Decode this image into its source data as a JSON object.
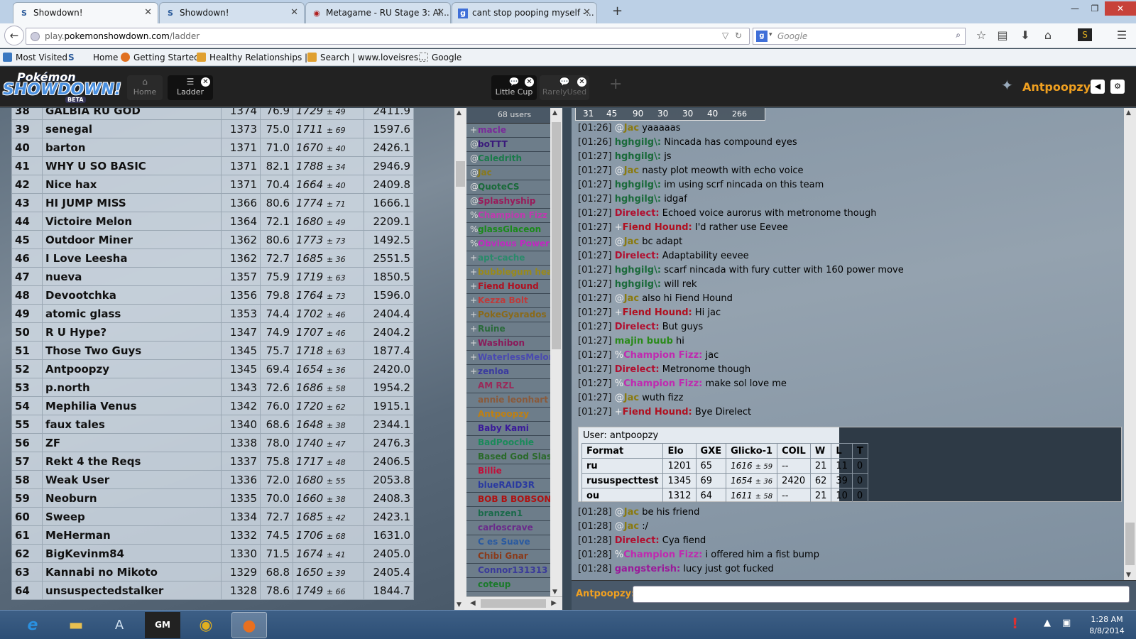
{
  "browser": {
    "tabs": [
      {
        "title": "Showdown!",
        "favicon": "S"
      },
      {
        "title": "Showdown!",
        "favicon": "S"
      },
      {
        "title": "Metagame - RU Stage 3: Al...",
        "favicon": "◉"
      },
      {
        "title": "cant stop pooping myself -...",
        "favicon": "g"
      }
    ],
    "new_tab": "+",
    "url_prefix": "play.",
    "url_domain": "pokemonshowdown.com",
    "url_path": "/ladder",
    "search_placeholder": "Google",
    "bookmarks": [
      "Most Visited",
      "Home",
      "Getting Started",
      "Healthy Relationships |...",
      "Search | www.loveisres...",
      "Google"
    ]
  },
  "showdown": {
    "logo_top": "Pokémon",
    "logo_main": "SHOWDOWN!",
    "logo_beta": "BETA",
    "tabs": [
      {
        "label": "Home",
        "icon": "⌂"
      },
      {
        "label": "Ladder",
        "icon": "☰"
      },
      {
        "label": "Little Cup",
        "icon": "💬"
      },
      {
        "label": "RarelyUsed",
        "icon": "💬"
      }
    ],
    "add_tab": "+",
    "username": "Antpoopzy"
  },
  "ladder": {
    "rows": [
      [
        "38",
        "GALBIA RU GOD",
        "1374",
        "76.9",
        "1729",
        "± 49",
        "2411.9"
      ],
      [
        "39",
        "senegal",
        "1373",
        "75.0",
        "1711",
        "± 69",
        "1597.6"
      ],
      [
        "40",
        "barton",
        "1371",
        "71.0",
        "1670",
        "± 40",
        "2426.1"
      ],
      [
        "41",
        "WHY U SO BASIC",
        "1371",
        "82.1",
        "1788",
        "± 34",
        "2946.9"
      ],
      [
        "42",
        "Nice hax",
        "1371",
        "70.4",
        "1664",
        "± 40",
        "2409.8"
      ],
      [
        "43",
        "HI JUMP MISS",
        "1366",
        "80.6",
        "1774",
        "± 71",
        "1666.1"
      ],
      [
        "44",
        "Victoire Melon",
        "1364",
        "72.1",
        "1680",
        "± 49",
        "2209.1"
      ],
      [
        "45",
        "Outdoor Miner",
        "1362",
        "80.6",
        "1773",
        "± 73",
        "1492.5"
      ],
      [
        "46",
        "I Love Leesha",
        "1362",
        "72.7",
        "1685",
        "± 36",
        "2551.5"
      ],
      [
        "47",
        "nueva",
        "1357",
        "75.9",
        "1719",
        "± 63",
        "1850.5"
      ],
      [
        "48",
        "Devootchka",
        "1356",
        "79.8",
        "1764",
        "± 73",
        "1596.0"
      ],
      [
        "49",
        "atomic glass",
        "1353",
        "74.4",
        "1702",
        "± 46",
        "2404.4"
      ],
      [
        "50",
        "R U Hype?",
        "1347",
        "74.9",
        "1707",
        "± 46",
        "2404.2"
      ],
      [
        "51",
        "Those Two Guys",
        "1345",
        "75.7",
        "1718",
        "± 63",
        "1877.4"
      ],
      [
        "52",
        "Antpoopzy",
        "1345",
        "69.4",
        "1654",
        "± 36",
        "2420.0"
      ],
      [
        "53",
        "p.north",
        "1343",
        "72.6",
        "1686",
        "± 58",
        "1954.2"
      ],
      [
        "54",
        "Mephilia Venus",
        "1342",
        "76.0",
        "1720",
        "± 62",
        "1915.1"
      ],
      [
        "55",
        "faux tales",
        "1340",
        "68.6",
        "1648",
        "± 38",
        "2344.1"
      ],
      [
        "56",
        "ZF",
        "1338",
        "78.0",
        "1740",
        "± 47",
        "2476.3"
      ],
      [
        "57",
        "Rekt 4 the Reqs",
        "1337",
        "75.8",
        "1717",
        "± 48",
        "2406.5"
      ],
      [
        "58",
        "Weak User",
        "1336",
        "72.0",
        "1680",
        "± 55",
        "2053.8"
      ],
      [
        "59",
        "Neoburn",
        "1335",
        "70.0",
        "1660",
        "± 38",
        "2408.3"
      ],
      [
        "60",
        "Sweep",
        "1334",
        "72.7",
        "1685",
        "± 42",
        "2423.1"
      ],
      [
        "61",
        "MeHerman",
        "1332",
        "74.5",
        "1706",
        "± 68",
        "1631.0"
      ],
      [
        "62",
        "BigKevinm84",
        "1330",
        "71.5",
        "1674",
        "± 41",
        "2405.0"
      ],
      [
        "63",
        "Kannabi no Mikoto",
        "1329",
        "68.8",
        "1650",
        "± 39",
        "2405.4"
      ],
      [
        "64",
        "unsuspectedstalker",
        "1328",
        "78.6",
        "1749",
        "± 66",
        "1844.7"
      ]
    ]
  },
  "userlist": {
    "count": "68 users",
    "users": [
      {
        "g": "+",
        "n": "macle",
        "c": "#7a2a9a"
      },
      {
        "g": "@",
        "n": "boTTT",
        "c": "#3a1a7a"
      },
      {
        "g": "@",
        "n": "Caledrith",
        "c": "#1a7a4a"
      },
      {
        "g": "@",
        "n": "Jac",
        "c": "#8a7a1a"
      },
      {
        "g": "@",
        "n": "QuoteCS",
        "c": "#1a6a3a"
      },
      {
        "g": "@",
        "n": "Splashyship",
        "c": "#9a1a5a"
      },
      {
        "g": "%",
        "n": "Champion Fizz",
        "c": "#c03ab0"
      },
      {
        "g": "%",
        "n": "glassGlaceon",
        "c": "#1a8a1a"
      },
      {
        "g": "%",
        "n": "Obvious Power",
        "c": "#c02ac0"
      },
      {
        "g": "+",
        "n": "apt-cache",
        "c": "#2a8a6a"
      },
      {
        "g": "+",
        "n": "bubblegum heart",
        "c": "#9a8a1a"
      },
      {
        "g": "+",
        "n": "Fiend Hound",
        "c": "#b01020"
      },
      {
        "g": "+",
        "n": "Kezza Bolt",
        "c": "#c03a3a"
      },
      {
        "g": "+",
        "n": "PokeGyarados",
        "c": "#8a6a1a"
      },
      {
        "g": "+",
        "n": "Ruine",
        "c": "#2a6a3a"
      },
      {
        "g": "+",
        "n": "Washibon",
        "c": "#8a1a5a"
      },
      {
        "g": "+",
        "n": "WaterlessMelon",
        "c": "#4a4ab0"
      },
      {
        "g": "+",
        "n": "zenloa",
        "c": "#3a3aa0"
      },
      {
        "g": "",
        "n": "AM RZL",
        "c": "#9a2a5a"
      },
      {
        "g": "",
        "n": "annie leonhart",
        "c": "#8a5a3a"
      },
      {
        "g": "",
        "n": "Antpoopzy",
        "c": "#c08010"
      },
      {
        "g": "",
        "n": "Baby Kami",
        "c": "#3a1a9a"
      },
      {
        "g": "",
        "n": "BadPoochie",
        "c": "#1a8a5a"
      },
      {
        "g": "",
        "n": "Based God Slash",
        "c": "#2a6a2a"
      },
      {
        "g": "",
        "n": "Billie",
        "c": "#c0103a"
      },
      {
        "g": "",
        "n": "blueRAID3R",
        "c": "#2a3aa0"
      },
      {
        "g": "",
        "n": "BOB B BOBSON",
        "c": "#b01010"
      },
      {
        "g": "",
        "n": "branzen1",
        "c": "#1a6a4a"
      },
      {
        "g": "",
        "n": "carloscrave",
        "c": "#6a2a8a"
      },
      {
        "g": "",
        "n": "C es Suave",
        "c": "#2a5aa0"
      },
      {
        "g": "",
        "n": "Chibi Gnar",
        "c": "#8a3a1a"
      },
      {
        "g": "",
        "n": "Connor131313",
        "c": "#3a3a9a"
      },
      {
        "g": "",
        "n": "coteup",
        "c": "#1a7a2a"
      }
    ]
  },
  "chat": {
    "stats": [
      "31",
      "45",
      "90",
      "30",
      "30",
      "40",
      "266"
    ],
    "messages_a": [
      {
        "t": "[01:26]",
        "g": "@",
        "n": "Jac",
        "c": "#8a7a10",
        "m": "yaaaaas"
      },
      {
        "t": "[01:26]",
        "g": "",
        "n": "hghgilg\\:",
        "c": "#1a6a3a",
        "m": "Nincada has compound eyes"
      },
      {
        "t": "[01:27]",
        "g": "",
        "n": "hghgilg\\:",
        "c": "#1a6a3a",
        "m": "js"
      },
      {
        "t": "[01:27]",
        "g": "@",
        "n": "Jac",
        "c": "#8a7a10",
        "m": "nasty plot meowth with echo voice"
      },
      {
        "t": "[01:27]",
        "g": "",
        "n": "hghgilg\\:",
        "c": "#1a6a3a",
        "m": "im using scrf nincada on this team"
      },
      {
        "t": "[01:27]",
        "g": "",
        "n": "hghgilg\\:",
        "c": "#1a6a3a",
        "m": "idgaf"
      },
      {
        "t": "[01:27]",
        "g": "",
        "n": "Direlect:",
        "c": "#b01030",
        "m": "Echoed voice aurorus with metronome though"
      },
      {
        "t": "[01:27]",
        "g": "+",
        "n": "Fiend Hound:",
        "c": "#b01020",
        "m": "I'd rather use Eevee"
      },
      {
        "t": "[01:27]",
        "g": "@",
        "n": "Jac",
        "c": "#8a7a10",
        "m": "bc adapt"
      },
      {
        "t": "[01:27]",
        "g": "",
        "n": "Direlect:",
        "c": "#b01030",
        "m": "Adaptability eevee"
      },
      {
        "t": "[01:27]",
        "g": "",
        "n": "hghgilg\\:",
        "c": "#1a6a3a",
        "m": "scarf nincada with fury cutter with 160 power move"
      },
      {
        "t": "[01:27]",
        "g": "",
        "n": "hghgilg\\:",
        "c": "#1a6a3a",
        "m": "will rek"
      },
      {
        "t": "[01:27]",
        "g": "@",
        "n": "Jac",
        "c": "#8a7a10",
        "m": "also hi Fiend Hound"
      },
      {
        "t": "[01:27]",
        "g": "+",
        "n": "Fiend Hound:",
        "c": "#b01020",
        "m": "Hi jac"
      },
      {
        "t": "[01:27]",
        "g": "",
        "n": "Direlect:",
        "c": "#b01030",
        "m": "But guys"
      },
      {
        "t": "[01:27]",
        "g": "",
        "n": "majin buub",
        "c": "#2a8a1a",
        "m": "hi"
      },
      {
        "t": "[01:27]",
        "g": "%",
        "n": "Champion Fizz:",
        "c": "#c02ab0",
        "m": "jac"
      },
      {
        "t": "[01:27]",
        "g": "",
        "n": "Direlect:",
        "c": "#b01030",
        "m": "Metronome though"
      },
      {
        "t": "[01:27]",
        "g": "%",
        "n": "Champion Fizz:",
        "c": "#c02ab0",
        "m": "make sol love me"
      },
      {
        "t": "[01:27]",
        "g": "@",
        "n": "Jac",
        "c": "#8a7a10",
        "m": "wuth fizz"
      },
      {
        "t": "[01:27]",
        "g": "+",
        "n": "Fiend Hound:",
        "c": "#b01020",
        "m": "Bye Direlect"
      }
    ],
    "userinfo": {
      "title": "User: antpoopzy",
      "headers": [
        "Format",
        "Elo",
        "GXE",
        "Glicko-1",
        "COIL",
        "W",
        "L",
        "T"
      ],
      "rows": [
        [
          "ru",
          "1201",
          "65",
          "1616",
          "± 59",
          "--",
          "21",
          "11",
          "0"
        ],
        [
          "rususpecttest",
          "1345",
          "69",
          "1654",
          "± 36",
          "2420",
          "62",
          "39",
          "0"
        ],
        [
          "ou",
          "1312",
          "64",
          "1611",
          "± 58",
          "--",
          "21",
          "10",
          "0"
        ]
      ]
    },
    "messages_b": [
      {
        "t": "[01:28]",
        "g": "@",
        "n": "Jac",
        "c": "#8a7a10",
        "m": "be his friend"
      },
      {
        "t": "[01:28]",
        "g": "@",
        "n": "Jac",
        "c": "#8a7a10",
        "m": ":/"
      },
      {
        "t": "[01:28]",
        "g": "",
        "n": "Direlect:",
        "c": "#b01030",
        "m": "Cya fiend"
      },
      {
        "t": "[01:28]",
        "g": "%",
        "n": "Champion Fizz:",
        "c": "#c02ab0",
        "m": "i offered him a fist bump"
      },
      {
        "t": "[01:28]",
        "g": "",
        "n": "gangsterish:",
        "c": "#9a1a9a",
        "m": "lucy just got fucked"
      }
    ],
    "input_label": "Antpoopzy:"
  },
  "taskbar": {
    "time": "1:28 AM",
    "date": "8/8/2014"
  }
}
